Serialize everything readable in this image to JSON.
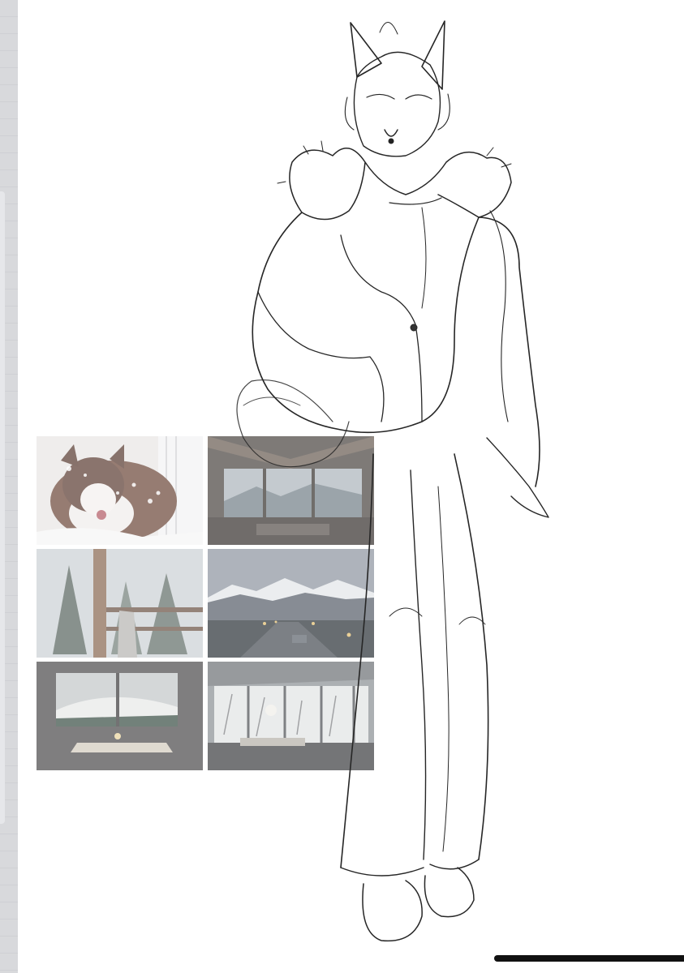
{
  "canvas": {
    "background": "#ffffff"
  },
  "moodboard": {
    "tiles": [
      {
        "name": "husky-in-snow",
        "palette": [
          "#d8d5d2",
          "#6b4a3f",
          "#f0eeee"
        ]
      },
      {
        "name": "cabin-interior-mountain-view",
        "palette": [
          "#6a6662",
          "#a9b3b8",
          "#3f3a36"
        ]
      },
      {
        "name": "misty-pine-forest-balcony",
        "palette": [
          "#c7ccd0",
          "#4a5650",
          "#7a6555"
        ]
      },
      {
        "name": "mountain-road-dusk",
        "palette": [
          "#8d95a0",
          "#39404a",
          "#d6b36a"
        ]
      },
      {
        "name": "window-table-snowy-hills",
        "palette": [
          "#5b5b5d",
          "#d5d6d4",
          "#8a8578"
        ]
      },
      {
        "name": "glass-room-snowy-trees",
        "palette": [
          "#9aa0a5",
          "#e3e4e3",
          "#4e4f52"
        ]
      }
    ]
  },
  "sketch": {
    "subject": "wolf-character-in-fur-coat",
    "stroke": "#2a2a2a"
  },
  "system": {
    "home_indicator_color": "#111111"
  }
}
